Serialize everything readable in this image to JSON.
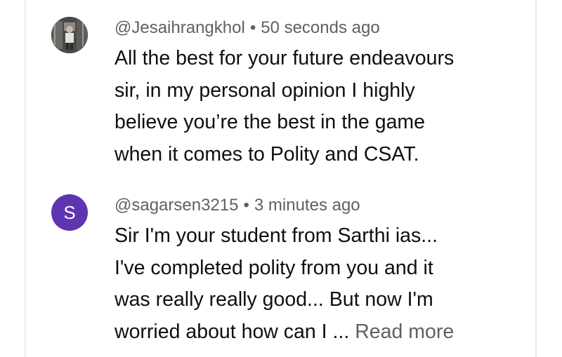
{
  "comments": [
    {
      "avatar": {
        "type": "photo",
        "icon": "user-photo-avatar"
      },
      "handle": "@Jesaihrangkhol",
      "separator": "•",
      "time": "50 seconds ago",
      "lines": [
        "All the best for your future endeavours",
        "sir, in my personal opinion I highly",
        "believe you’re the best in the game",
        "when it comes to Polity and CSAT."
      ]
    },
    {
      "avatar": {
        "type": "letter",
        "letter": "S",
        "color": "#5e35b1"
      },
      "handle": "@sagarsen3215",
      "separator": "•",
      "time": "3 minutes ago",
      "lines": [
        "Sir I'm your student from Sarthi ias...",
        "I've completed polity from you and it",
        "was really really good... But now I'm",
        "worried about how can I ..."
      ],
      "read_more": "Read more"
    }
  ]
}
